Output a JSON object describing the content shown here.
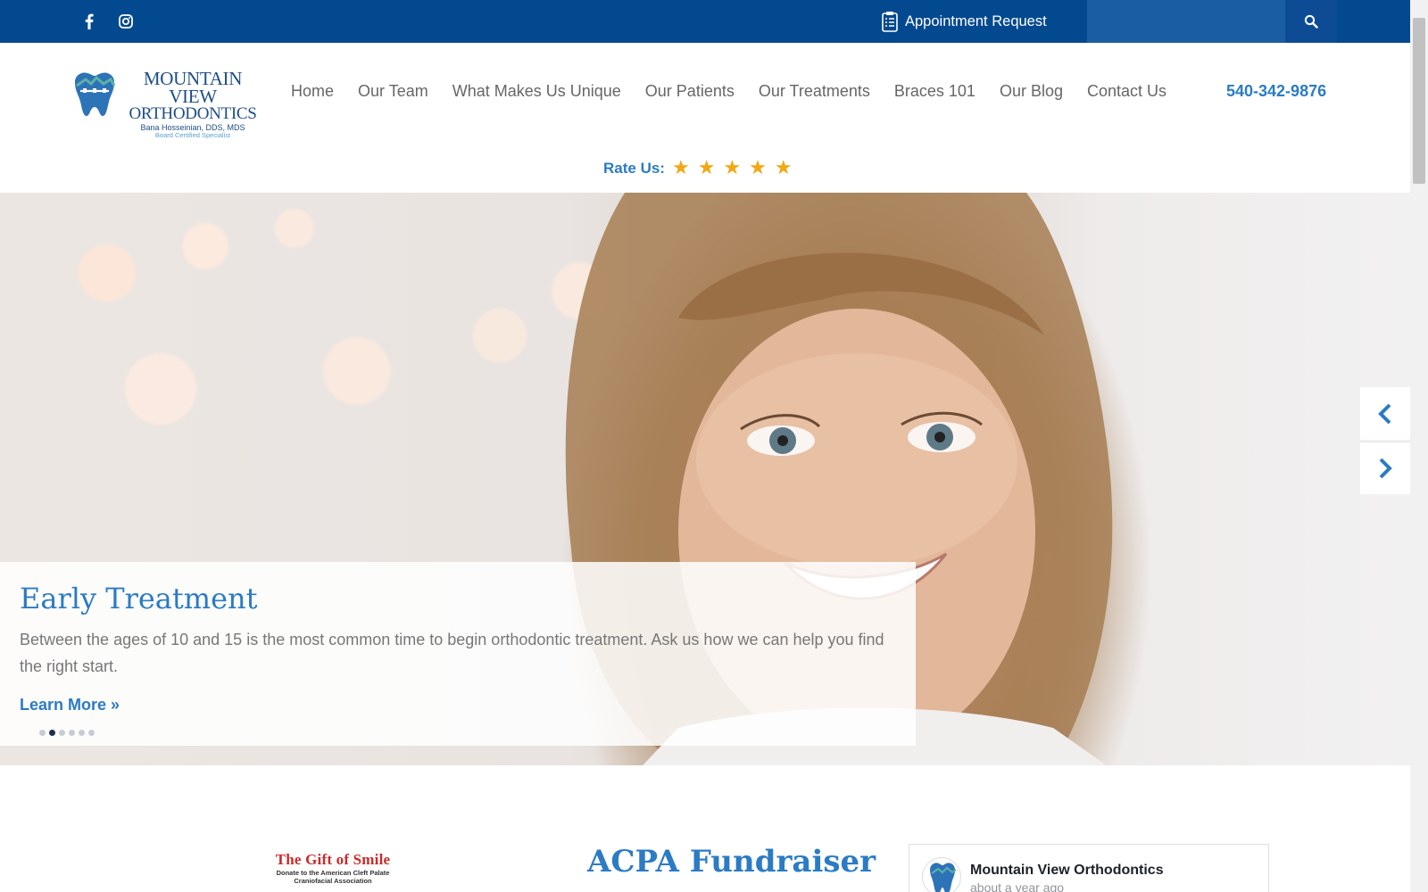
{
  "topbar": {
    "social": [
      {
        "icon": "facebook-icon"
      },
      {
        "icon": "instagram-icon"
      }
    ],
    "appointment_label": "Appointment Request",
    "search_placeholder": "",
    "colors": {
      "bar": "#03498f",
      "search_field": "#1a5da2"
    }
  },
  "header": {
    "logo": {
      "title_line1": "MOUNTAIN VIEW",
      "title_line2": "ORTHODONTICS",
      "doctor": "Bana Hosseinian, DDS, MDS",
      "specialist": "Board Certified Specialist"
    },
    "nav": [
      "Home",
      "Our Team",
      "What Makes Us Unique",
      "Our Patients",
      "Our Treatments",
      "Braces 101",
      "Our Blog",
      "Contact Us"
    ],
    "phone": "540-342-9876",
    "rate_label": "Rate Us:",
    "stars": [
      "★",
      "★",
      "★",
      "★",
      "★"
    ],
    "accent_color": "#2b7bc5",
    "star_color": "#f3a712"
  },
  "hero": {
    "slide_title": "Early Treatment",
    "slide_text": "Between the ages of 10 and 15 is the most common time to begin orthodontic treatment. Ask us how we can help you find the right start.",
    "cta": "Learn More »",
    "slide_count": 6,
    "active_slide": 2
  },
  "lower": {
    "gift_title": "The Gift of Smile",
    "gift_sub_line1": "Donate to the American Cleft Palate",
    "gift_sub_line2": "Craniofacial Association",
    "heading": "ACPA Fundraiser",
    "fb_page_name": "Mountain View Orthodontics",
    "fb_time": "about a year ago"
  }
}
